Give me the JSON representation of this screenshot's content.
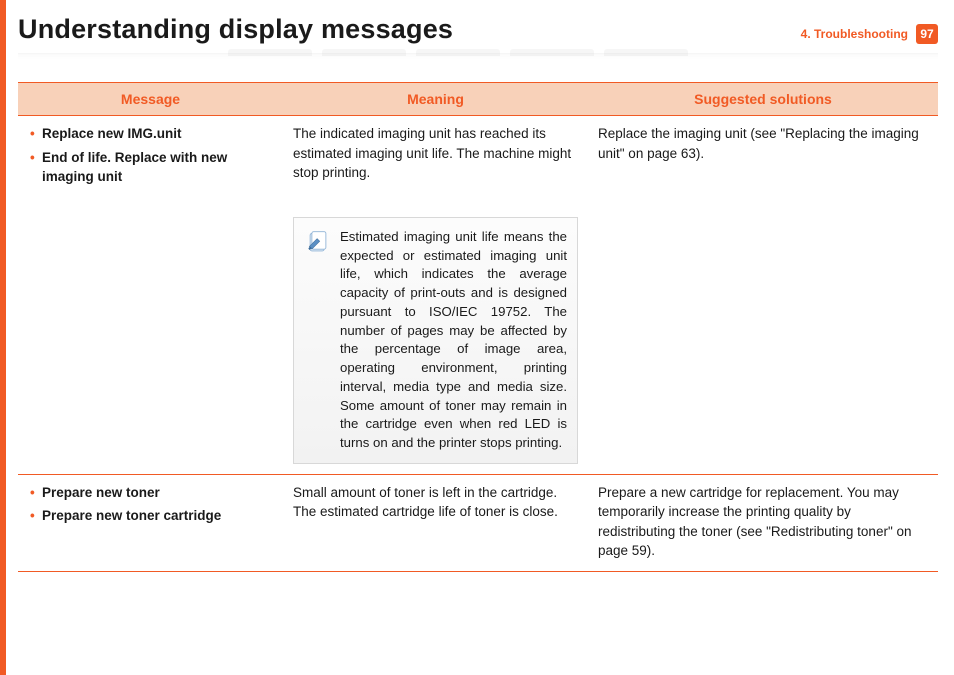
{
  "header": {
    "title": "Understanding display messages",
    "section": "4.  Troubleshooting",
    "page_number": "97"
  },
  "table": {
    "headers": [
      "Message",
      "Meaning",
      "Suggested solutions"
    ],
    "rows": [
      {
        "messages": [
          "Replace new IMG.unit",
          "End of life. Replace with new imaging unit"
        ],
        "meaning": "The indicated imaging unit has reached its estimated imaging unit life. The machine might stop printing.",
        "note": "Estimated imaging unit life means the expected or estimated imaging unit life, which indicates the average capacity of print-outs and is designed pursuant to ISO/IEC 19752. The number of pages may be affected by the percentage of image area, operating environment, printing interval, media type and media size. Some amount of toner may remain in the cartridge even when red LED is turns on and the printer stops printing.",
        "solution": "Replace the imaging unit (see \"Replacing the imaging unit\" on page 63)."
      },
      {
        "messages": [
          "Prepare new toner",
          "Prepare new toner cartridge"
        ],
        "meaning": "Small amount of toner is left in the cartridge. The estimated cartridge life of toner is close.",
        "note": null,
        "solution": "Prepare a new cartridge for replacement. You may temporarily increase the printing quality by redistributing the toner (see \"Redistributing toner\" on page 59)."
      }
    ]
  }
}
